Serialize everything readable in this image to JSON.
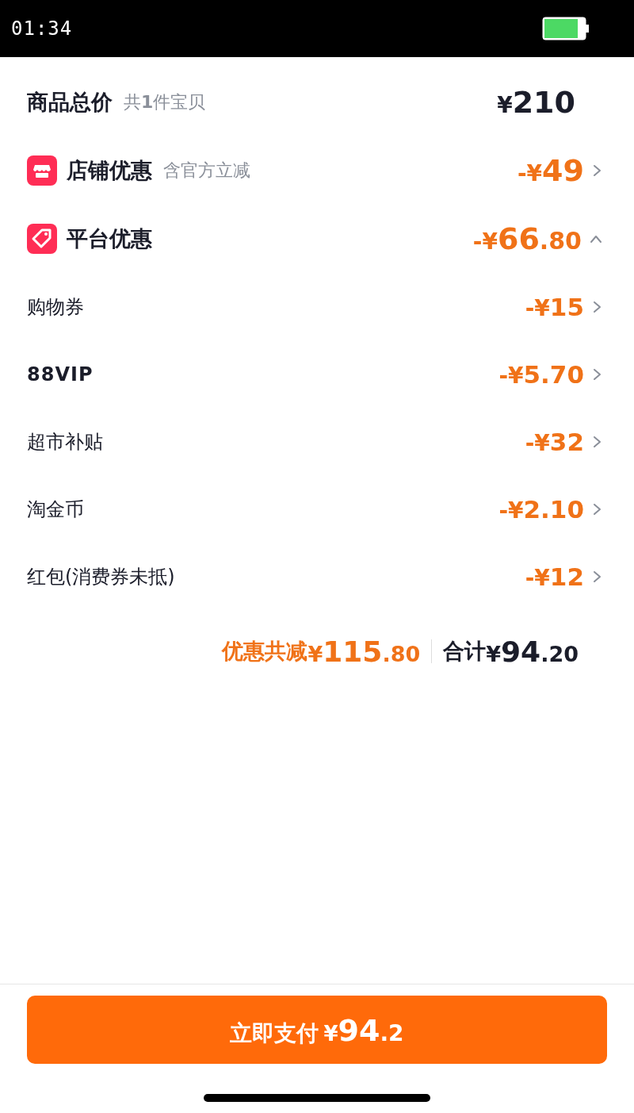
{
  "status_bar": {
    "time": "01:34"
  },
  "subtotal": {
    "label": "商品总价",
    "note": "共**1**件宝贝",
    "amount": "¥210"
  },
  "store_discount": {
    "label": "店铺优惠",
    "note": "含官方立减",
    "amount": "-¥49"
  },
  "platform_discount": {
    "label": "平台优惠",
    "amount": "-¥66.80",
    "expanded": true
  },
  "platform_items": [
    {
      "label": "购物券",
      "amount": "-¥15",
      "bold": false
    },
    {
      "label": "88VIP",
      "amount": "-¥5.70",
      "bold": true
    },
    {
      "label": "超市补贴",
      "amount": "-¥32",
      "bold": false
    },
    {
      "label": "淘金币",
      "amount": "-¥2.10",
      "bold": false
    },
    {
      "label": "红包(消费券未抵)",
      "amount": "-¥12",
      "bold": false
    }
  ],
  "summary": {
    "discount_label": "优惠共减",
    "discount_amount": "¥115.80",
    "total_label": "合计",
    "total_amount": "¥94.20"
  },
  "pay_button": {
    "label": "立即支付",
    "amount": "¥94.2"
  }
}
